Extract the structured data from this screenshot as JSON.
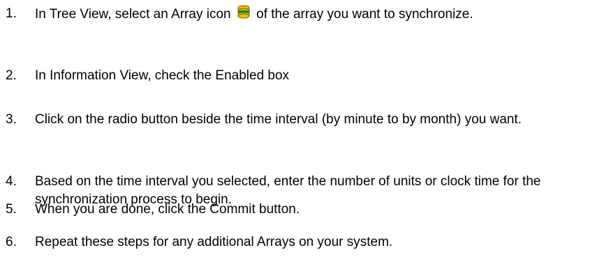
{
  "steps": [
    {
      "number": "1.",
      "text_before_icon": "In Tree View, select an Array icon",
      "icon": "array-icon",
      "text_after_icon": "of the array you want to synchronize."
    },
    {
      "number": "2.",
      "text": "In Information View, check the Enabled box"
    },
    {
      "number": "3.",
      "text": "Click on the radio button beside the time interval (by minute to by month) you want."
    },
    {
      "number": "4.",
      "text": "Based on the time interval you selected, enter the number of units or clock time for the synchronization process to begin."
    },
    {
      "number": "5.",
      "text": "When you are done, click the Commit button."
    },
    {
      "number": "6.",
      "text": "Repeat these steps for any additional Arrays on your system."
    }
  ],
  "colors": {
    "text": "#000000",
    "background": "#ffffff",
    "icon_fill": "#e8c200",
    "icon_accent": "#2f9e2f"
  }
}
